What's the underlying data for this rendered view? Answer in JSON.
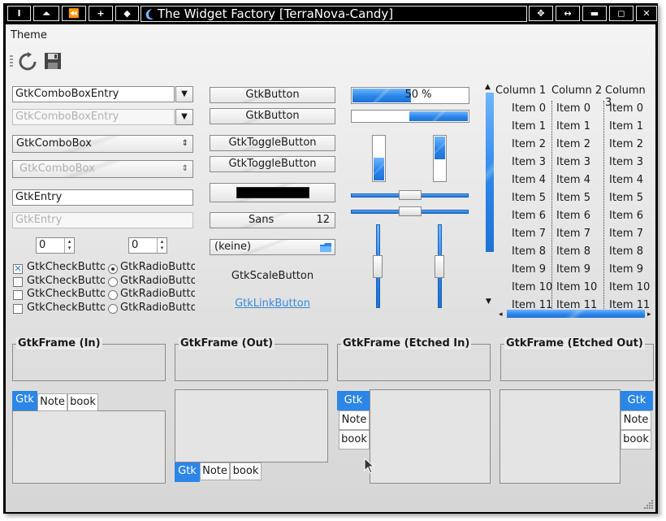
{
  "window": {
    "title": "The Widget Factory [TerraNova-Candy]",
    "left_buttons": [
      "I",
      "⏶",
      "⏪",
      "+",
      "◆"
    ],
    "right_buttons": [
      "✥",
      "↔",
      "▬",
      "◻",
      "✕"
    ]
  },
  "menu": {
    "theme_label": "Theme"
  },
  "toolbar": {
    "refresh_icon": "refresh-icon",
    "save_icon": "save-icon"
  },
  "col1": {
    "combo_entry": "GtkComboBoxEntry",
    "combo_entry_dis": "GtkComboBoxEntry",
    "combo": "GtkComboBox",
    "combo_dis": "GtkComboBox",
    "entry": "GtkEntry",
    "entry_dis": "GtkEntry",
    "spin1": "0",
    "spin2": "0",
    "checks": [
      "GtkCheckButton",
      "GtkCheckButton",
      "GtkCheckButton",
      "GtkCheckButton"
    ],
    "radios": [
      "GtkRadioButton",
      "GtkRadioButton",
      "GtkRadioButton",
      "GtkRadioButton"
    ]
  },
  "col2": {
    "button1": "GtkButton",
    "button2": "GtkButton",
    "toggle1": "GtkToggleButton",
    "toggle2": "GtkToggleButton",
    "color_value": "#000000",
    "font_name": "Sans",
    "font_size": "12",
    "file_chooser": "(keine)",
    "scale_button": "GtkScaleButton",
    "link_button": "GtkLinkButton"
  },
  "col3": {
    "progress_text": "50 %",
    "progress_fraction": 0.5,
    "progress2_fraction": 0.5,
    "vprogress1_fraction": 0.5,
    "vprogress2_fraction": 0.5,
    "hscale1_value": 0.5,
    "hscale2_value": 0.5,
    "vscale1_value": 0.5,
    "vscale2_value": 0.5
  },
  "tree": {
    "columns": [
      "Column 1",
      "Column 2",
      "Column 3"
    ],
    "rows": [
      [
        "Item 0",
        "Item 0",
        "Item 0"
      ],
      [
        "Item 1",
        "Item 1",
        "Item 1"
      ],
      [
        "Item 2",
        "Item 2",
        "Item 2"
      ],
      [
        "Item 3",
        "Item 3",
        "Item 3"
      ],
      [
        "Item 4",
        "Item 4",
        "Item 4"
      ],
      [
        "Item 5",
        "Item 5",
        "Item 5"
      ],
      [
        "Item 6",
        "Item 6",
        "Item 6"
      ],
      [
        "Item 7",
        "Item 7",
        "Item 7"
      ],
      [
        "Item 8",
        "Item 8",
        "Item 8"
      ],
      [
        "Item 9",
        "Item 9",
        "Item 9"
      ],
      [
        "Item 10",
        "Item 10",
        "Item 10"
      ],
      [
        "Item 11",
        "Item 11",
        "Item 11"
      ]
    ]
  },
  "frames": [
    "GtkFrame (In)",
    "GtkFrame (Out)",
    "GtkFrame (Etched In)",
    "GtkFrame (Etched Out)"
  ],
  "notebooks": {
    "tabs": [
      "Gtk",
      "Note",
      "book"
    ]
  },
  "colors": {
    "accent": "#2b86e8",
    "titlebar": "#000000",
    "link": "#3a8ad8"
  }
}
